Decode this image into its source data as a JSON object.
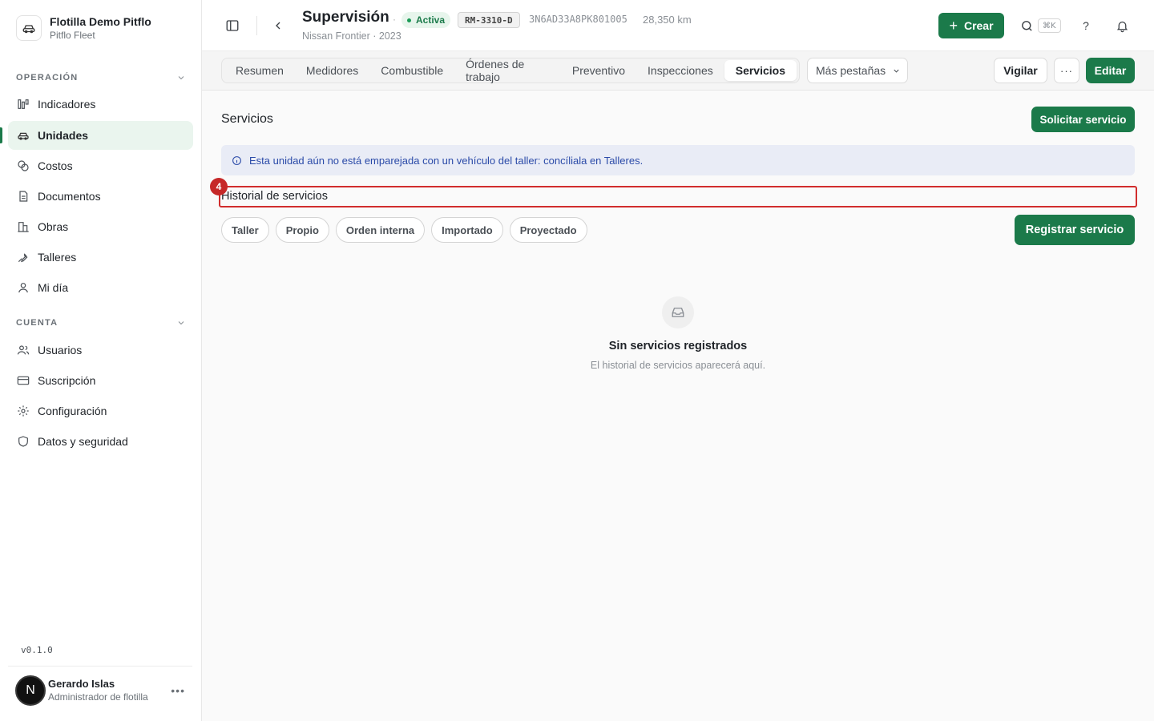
{
  "org": {
    "name": "Flotilla Demo Pitflo",
    "subtitle": "Pitflo Fleet",
    "logo_icon": "car-icon"
  },
  "sidebar": {
    "sections": [
      {
        "label": "OPERACIÓN",
        "items": [
          {
            "label": "Indicadores",
            "icon": "chart-columns-icon"
          },
          {
            "label": "Unidades",
            "icon": "car-icon",
            "active": true
          },
          {
            "label": "Costos",
            "icon": "coins-icon"
          },
          {
            "label": "Documentos",
            "icon": "document-icon"
          },
          {
            "label": "Obras",
            "icon": "buildings-icon"
          },
          {
            "label": "Talleres",
            "icon": "wrench-icon"
          },
          {
            "label": "Mi día",
            "icon": "user-icon"
          }
        ]
      },
      {
        "label": "CUENTA",
        "items": [
          {
            "label": "Usuarios",
            "icon": "users-icon"
          },
          {
            "label": "Suscripción",
            "icon": "credit-card-icon"
          },
          {
            "label": "Configuración",
            "icon": "gear-icon"
          },
          {
            "label": "Datos y seguridad",
            "icon": "shield-icon"
          }
        ]
      }
    ],
    "version": "v0.1.0",
    "user": {
      "initial": "N",
      "name": "Gerardo Islas",
      "role": "Administrador de flotilla"
    }
  },
  "header": {
    "title": "Supervisión",
    "status": "Activa",
    "plate": "RM-3310-D",
    "vin": "3N6AD33A8PK801005",
    "odometer": "28,350 km",
    "subtitle": "Nissan Frontier · 2023",
    "create_label": "Crear",
    "shortcut": "⌘K",
    "help_label": "?"
  },
  "tabs": {
    "items": [
      "Resumen",
      "Medidores",
      "Combustible",
      "Órdenes de trabajo",
      "Preventivo",
      "Inspecciones",
      "Servicios"
    ],
    "active": "Servicios",
    "more_label": "Más pestañas",
    "watch_label": "Vigilar",
    "more_actions_label": "···",
    "edit_label": "Editar"
  },
  "content": {
    "title": "Servicios",
    "request_label": "Solicitar servicio",
    "info_message": "Esta unidad aún no está emparejada con un vehículo del taller: concíliala en Talleres.",
    "history_title": "Historial de servicios",
    "annotation_number": "4",
    "filters": [
      "Taller",
      "Propio",
      "Orden interna",
      "Importado",
      "Proyectado"
    ],
    "register_label": "Registrar servicio",
    "empty_title": "Sin servicios registrados",
    "empty_subtitle": "El historial de servicios aparecerá aquí."
  },
  "colors": {
    "accent": "#1b7a4a",
    "active_bg": "#eaf5ee",
    "info_bg": "#e9ecf6",
    "info_text": "#2a4aa8",
    "highlight": "#d12d2d"
  }
}
